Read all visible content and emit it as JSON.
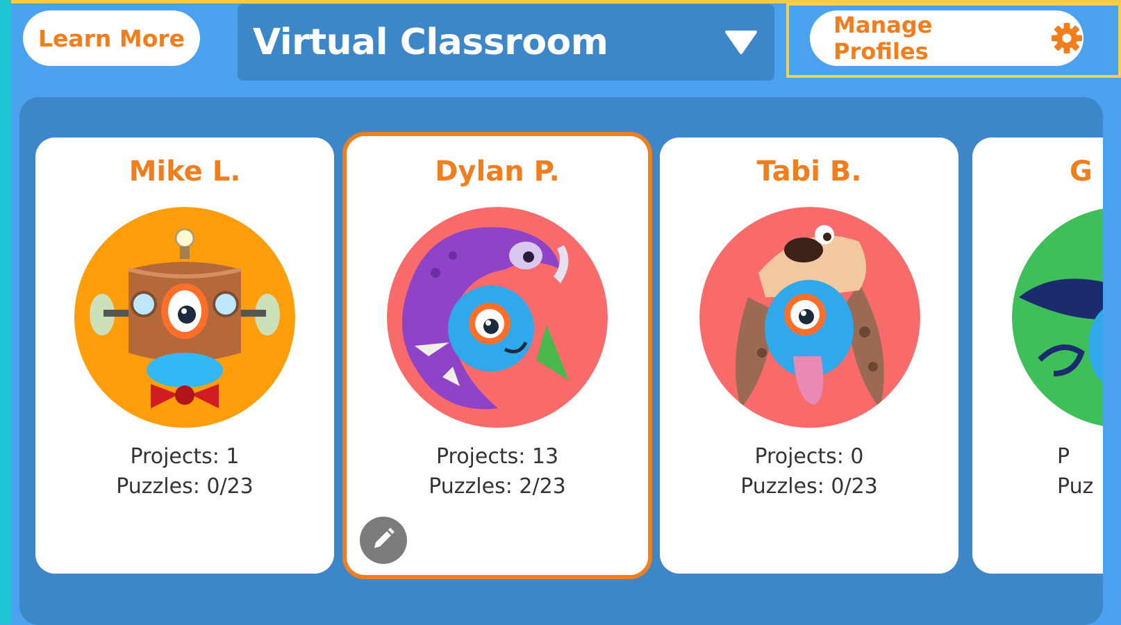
{
  "header": {
    "learn_more_label": "Learn More",
    "classroom_selector": {
      "selected": "Virtual Classroom"
    },
    "manage_profiles_label": "Manage Profiles"
  },
  "profiles": [
    {
      "name": "Mike L.",
      "projects": "Projects: 1",
      "puzzles": "Puzzles: 0/23",
      "avatar_color": "#ff9d0a",
      "avatar": "robot-avatar"
    },
    {
      "name": "Dylan P.",
      "projects": "Projects: 13",
      "puzzles": "Puzzles: 2/23",
      "avatar_color": "#f96a6a",
      "avatar": "monster-avatar",
      "selected": true
    },
    {
      "name": "Tabi B.",
      "projects": "Projects: 0",
      "puzzles": "Puzzles: 0/23",
      "avatar_color": "#f96a6a",
      "avatar": "dog-avatar"
    },
    {
      "name": "G",
      "projects": "P",
      "puzzles": "Puz",
      "avatar_color": "#3fbf5a",
      "avatar": "wizard-avatar"
    }
  ],
  "colors": {
    "accent": "#f07d1e",
    "background": "#4aa2ee",
    "panel": "#3d87c9",
    "highlight": "#f5d24a"
  }
}
